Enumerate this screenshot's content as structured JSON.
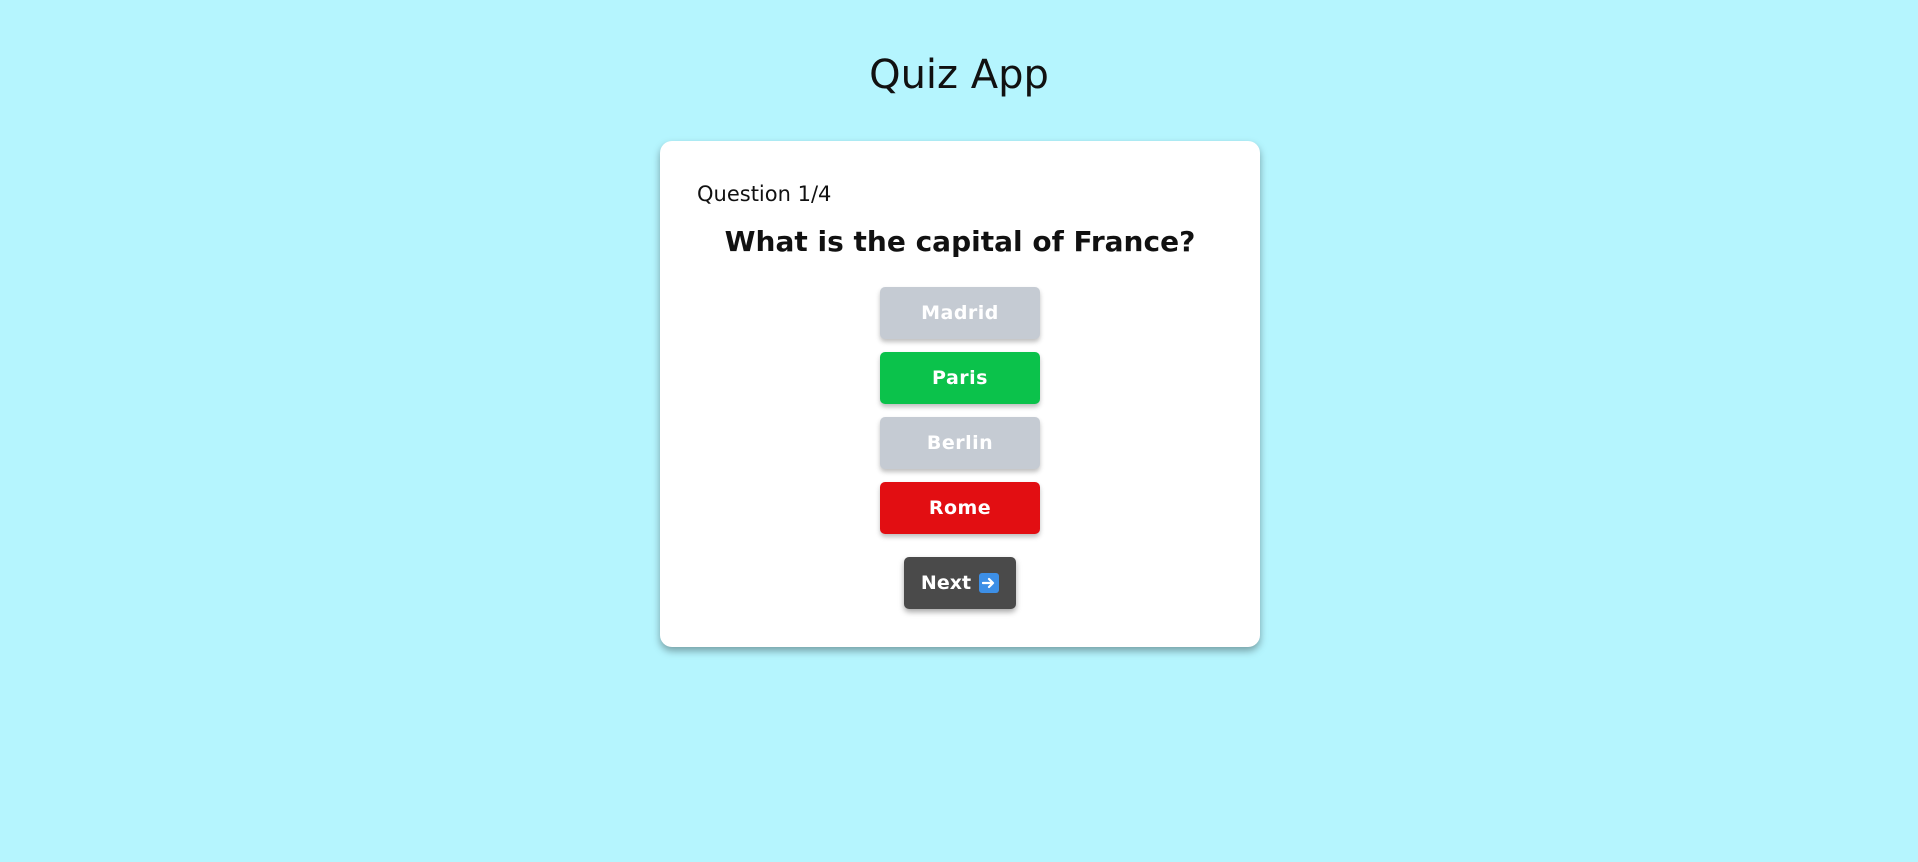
{
  "app": {
    "title": "Quiz App"
  },
  "quiz": {
    "counter": "Question 1/4",
    "question": "What is the capital of France?",
    "options": [
      {
        "label": "Madrid",
        "state": "neutral"
      },
      {
        "label": "Paris",
        "state": "correct"
      },
      {
        "label": "Berlin",
        "state": "neutral"
      },
      {
        "label": "Rome",
        "state": "wrong"
      }
    ],
    "next_label": "Next",
    "next_icon": "right-arrow-icon"
  },
  "colors": {
    "background": "#b5f5fe",
    "neutral": "#c5cbd3",
    "correct": "#0bc24b",
    "wrong": "#e20e12",
    "next": "#4a4a4a",
    "arrow_icon": "#3d8fe6"
  }
}
